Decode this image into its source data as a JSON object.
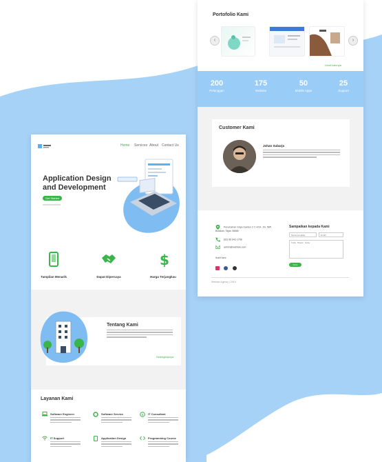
{
  "portfolio": {
    "title": "Portofolio Kami",
    "more_link": "Lihat Lainnya",
    "prev_icon": "chevron-left-icon",
    "next_icon": "chevron-right-icon"
  },
  "stats": [
    {
      "value": "200",
      "label": "Pelanggan"
    },
    {
      "value": "175",
      "label": "Website"
    },
    {
      "value": "50",
      "label": "Mobile Apps"
    },
    {
      "value": "25",
      "label": "Support"
    }
  ],
  "customer": {
    "title": "Customer Kami",
    "name": "Johan Subarjo"
  },
  "contact": {
    "address": "Perumahan Griya Gardun 2 C-4/14, Jln. 58P, Bulakan, Tajau 36666",
    "phone": "(62) 85 642-1756",
    "email": "admin@webtaw.com",
    "social_label": "Ikuti Kami"
  },
  "form": {
    "title": "Sampaikan kepada Kami",
    "name_placeholder": "Nama Lengkap",
    "email_placeholder": "Email",
    "message_placeholder": "Teks Pesan Anda",
    "send_label": "Kirim"
  },
  "copyright": "Webtaw Agency | 2019",
  "nav": {
    "items": [
      "Home",
      "Services",
      "About",
      "Contact Us"
    ]
  },
  "hero": {
    "title_line1": "Application Design",
    "title_line2": "and Development",
    "cta": "Get Started"
  },
  "features": [
    {
      "label": "Tampilan Menarik",
      "icon": "mobile-phone-icon"
    },
    {
      "label": "Dapat Dipercaya",
      "icon": "handshake-icon"
    },
    {
      "label": "Harga Terjangkau",
      "icon": "dollar-icon"
    }
  ],
  "about": {
    "title": "Tentang Kami",
    "more_link": "Selengkapnya"
  },
  "services": {
    "title": "Layanan Kami",
    "items": [
      {
        "label": "Software Engineer",
        "icon": "laptop-icon"
      },
      {
        "label": "Software Service",
        "icon": "gear-icon"
      },
      {
        "label": "IT Consultant",
        "icon": "info-icon"
      },
      {
        "label": "IT Support",
        "icon": "wifi-icon"
      },
      {
        "label": "Application Design",
        "icon": "tablet-icon"
      },
      {
        "label": "Programming Course",
        "icon": "code-icon"
      }
    ]
  },
  "colors": {
    "accent": "#39b54a",
    "wave": "#a6d2f8",
    "stats_bg": "#99ccf7"
  }
}
